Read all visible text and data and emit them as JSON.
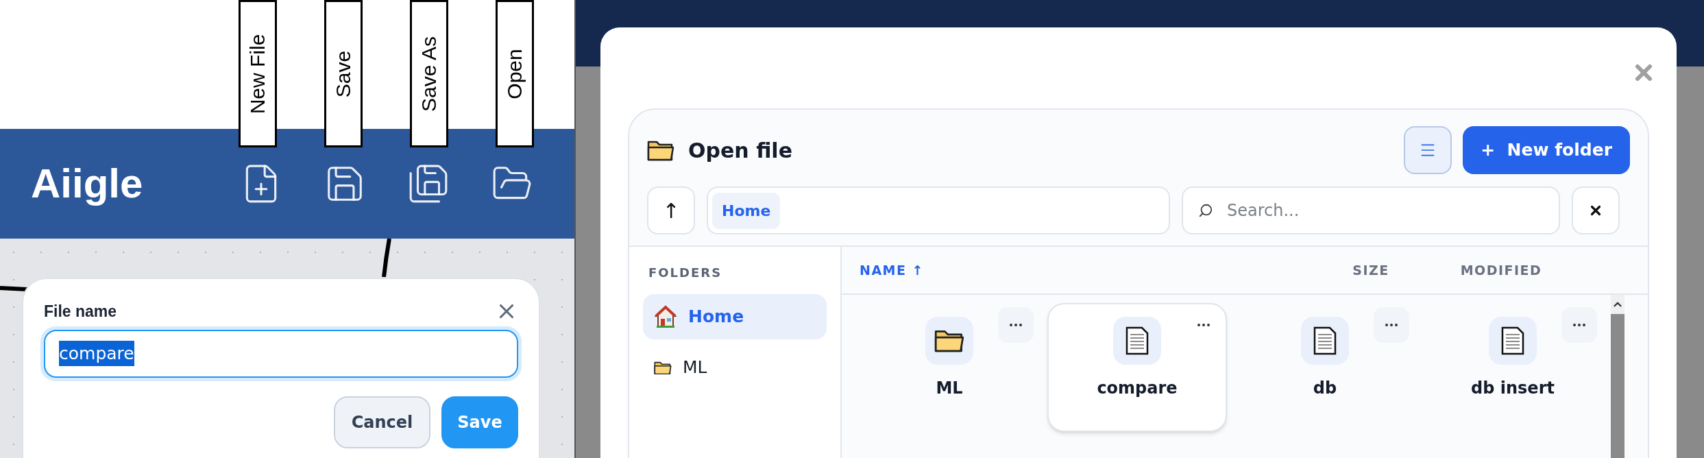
{
  "toolbar_labels": [
    "New File",
    "Save",
    "Save As",
    "Open"
  ],
  "app_bar": {
    "logo": "Aiigle",
    "tools": [
      {
        "kind": "new"
      },
      {
        "kind": "save"
      },
      {
        "kind": "save_as"
      },
      {
        "kind": "open"
      }
    ]
  },
  "save_dialog": {
    "label": "File name",
    "value": "compare",
    "buttons": [
      {
        "label": "Cancel",
        "kind": "secondary"
      },
      {
        "label": "Save",
        "kind": "primary"
      }
    ]
  },
  "open_dialog": {
    "title": "Open file",
    "new_folder": "+  New folder",
    "up": "↑",
    "breadcrumb": [
      "Home"
    ],
    "search": {
      "placeholder": "Search..."
    },
    "sidebar": {
      "heading": "FOLDERS",
      "items": [
        {
          "name": "Home",
          "kind": "home",
          "selected": true
        },
        {
          "name": "ML",
          "kind": "folder",
          "selected": false
        }
      ]
    },
    "columns": [
      {
        "label": "NAME ↑",
        "selected": true
      },
      {
        "label": "SIZE",
        "selected": false
      },
      {
        "label": "MODIFIED",
        "selected": false
      }
    ],
    "files": [
      {
        "name": "ML",
        "kind": "folder",
        "selected": false
      },
      {
        "name": "compare",
        "kind": "file",
        "selected": true
      },
      {
        "name": "db",
        "kind": "file",
        "selected": false
      },
      {
        "name": "db insert",
        "kind": "file",
        "selected": false
      }
    ]
  }
}
